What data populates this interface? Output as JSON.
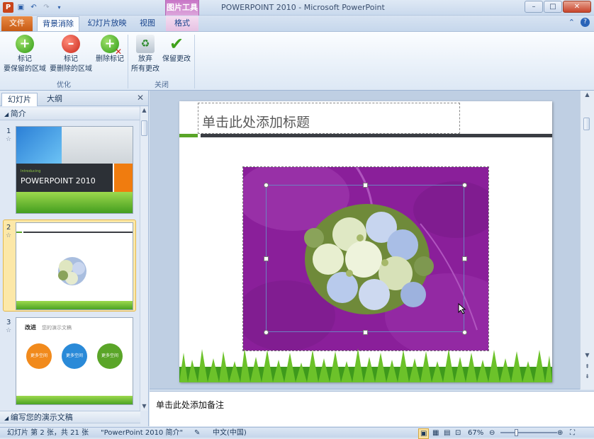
{
  "window": {
    "title": "POWERPOINT 2010 - Microsoft PowerPoint",
    "context_group": "图片工具",
    "buttons": {
      "minimize": "–",
      "maximize": "□",
      "close": "✕"
    }
  },
  "qat": {
    "save_icon": "save-icon",
    "undo_icon": "undo-icon",
    "redo_icon": "redo-icon"
  },
  "tabs": [
    {
      "label": "文件"
    },
    {
      "label": "背景消除"
    },
    {
      "label": "幻灯片放映"
    },
    {
      "label": "视图"
    },
    {
      "label": "格式"
    }
  ],
  "ribbon": {
    "buttons": [
      {
        "line1": "标记",
        "line2": "要保留的区域"
      },
      {
        "line1": "标记",
        "line2": "要删除的区域"
      },
      {
        "line1": "删除标记",
        "line2": ""
      },
      {
        "line1": "放弃",
        "line2": "所有更改"
      },
      {
        "line1": "保留更改",
        "line2": ""
      }
    ],
    "groups": [
      "优化",
      "关闭"
    ]
  },
  "left_pane": {
    "tabs": [
      "幻灯片",
      "大纲"
    ],
    "section_top": "简介",
    "section_bottom": "编写您的演示文稿",
    "slides": [
      {
        "num": "1",
        "text_small": "Introducing",
        "text_big": "POWERPOINT 2010"
      },
      {
        "num": "2"
      },
      {
        "num": "3",
        "heading": "改进",
        "heading_sub": "您的演示文稿",
        "circles": [
          "更多空间",
          "更多空间",
          "更多空间"
        ]
      }
    ]
  },
  "slide": {
    "title_placeholder": "单击此处添加标题"
  },
  "notes": {
    "placeholder": "单击此处添加备注"
  },
  "status": {
    "slide_info": "幻灯片 第 2 张，共 21 张",
    "theme": "\"PowerPoint 2010 简介\"",
    "language": "中文(中国)",
    "zoom": "67%"
  },
  "colors": {
    "photo_bg": "#8a1f9a",
    "file_tab": "#d4661c",
    "context_tab": "#c776c6",
    "accent_green": "#5aa528"
  }
}
